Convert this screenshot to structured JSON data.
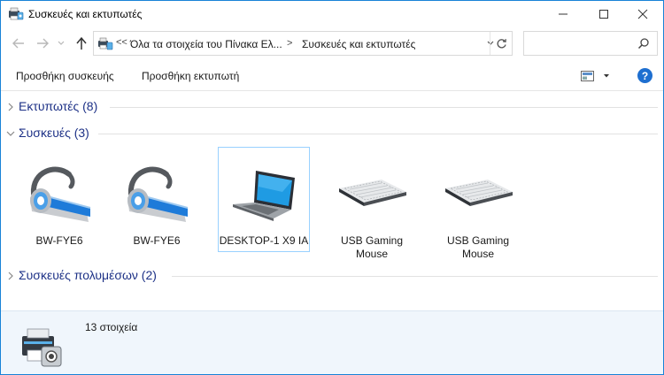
{
  "window": {
    "title": "Συσκευές και εκτυπωτές",
    "controls": [
      "minimize",
      "maximize",
      "close"
    ]
  },
  "navigation": {
    "address_overflow": "<<",
    "breadcrumbs": [
      "Όλα τα στοιχεία του Πίνακα Ελ...",
      "Συσκευές και εκτυπωτές"
    ],
    "breadcrumb_separator": ">",
    "search_placeholder": ""
  },
  "toolbar": {
    "add_device": "Προσθήκη συσκευής",
    "add_printer": "Προσθήκη εκτυπωτή",
    "help": "?"
  },
  "groups": [
    {
      "title": "Εκτυπωτές (8)",
      "expanded": false
    },
    {
      "title": "Συσκευές (3)",
      "expanded": true
    },
    {
      "title": "Συσκευές πολυμέσων (2)",
      "expanded": false
    }
  ],
  "devices": [
    {
      "label": "BW-FYE6",
      "icon": "headset-icon",
      "selected": false
    },
    {
      "label": "BW-FYE6",
      "icon": "headset-icon",
      "selected": false
    },
    {
      "label": "DESKTOP-1 X9 IA",
      "icon": "laptop-icon",
      "selected": true
    },
    {
      "label": "USB Gaming Mouse",
      "icon": "keyboard-icon",
      "selected": false
    },
    {
      "label": "USB Gaming Mouse",
      "icon": "keyboard-icon",
      "selected": false
    }
  ],
  "details": {
    "count": "13 στοιχεία",
    "icon": "devices-printers-icon"
  },
  "colors": {
    "accent": "#1883d7",
    "group_title": "#1e3287",
    "details_bg": "#f0f6fc",
    "selection_border": "#99d1ff"
  }
}
